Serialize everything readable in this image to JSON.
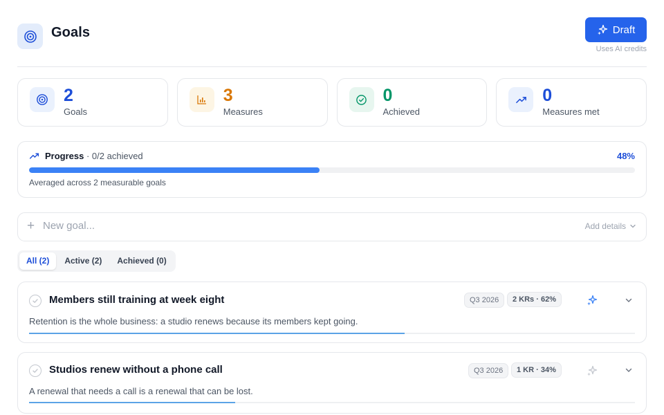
{
  "header": {
    "title": "Goals",
    "draft_label": "Draft",
    "credits_note": "Uses AI credits"
  },
  "stats": [
    {
      "value": "2",
      "label": "Goals",
      "icon": "target-icon",
      "color": "#1d4ed8"
    },
    {
      "value": "3",
      "label": "Measures",
      "icon": "bar-chart-icon",
      "color": "#d97706"
    },
    {
      "value": "0",
      "label": "Achieved",
      "icon": "check-circle-icon",
      "color": "#059669"
    },
    {
      "value": "0",
      "label": "Measures met",
      "icon": "trending-up-icon",
      "color": "#1d4ed8"
    }
  ],
  "progress": {
    "label": "Progress",
    "sub": " · 0/2 achieved",
    "percent_text": "48%",
    "percent": 48,
    "note": "Averaged across 2 measurable goals"
  },
  "new_goal": {
    "placeholder": "New goal...",
    "add_details": "Add details"
  },
  "tabs": [
    {
      "label": "All (2)",
      "active": true
    },
    {
      "label": "Active (2)",
      "active": false
    },
    {
      "label": "Achieved (0)",
      "active": false
    }
  ],
  "goals": [
    {
      "title": "Members still training at week eight",
      "quarter": "Q3 2026",
      "kr": "2 KRs · 62%",
      "progress": 62,
      "description": "Retention is the whole business: a studio renews because its members kept going."
    },
    {
      "title": "Studios renew without a phone call",
      "quarter": "Q3 2026",
      "kr": "1 KR · 34%",
      "progress": 34,
      "description": "A renewal that needs a call is a renewal that can be lost."
    }
  ],
  "colors": {
    "accent": "#2563eb",
    "progress_fill": "#3b82f6",
    "goal_fill": "#5ba3e6"
  }
}
